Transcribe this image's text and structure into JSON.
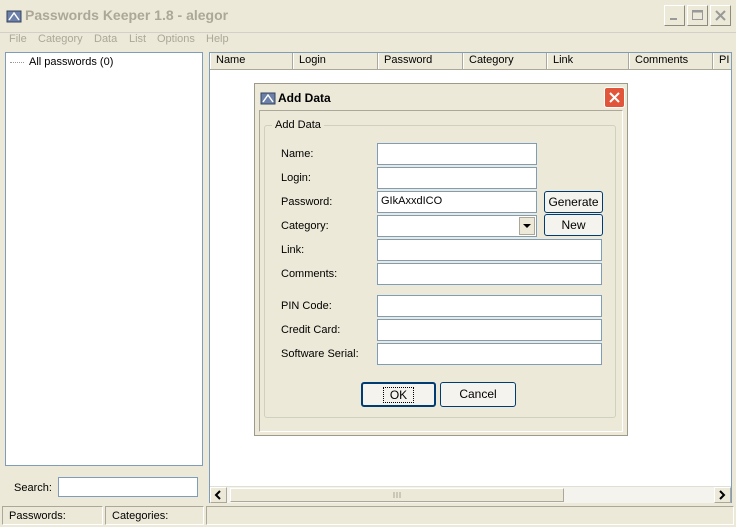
{
  "window": {
    "title": "Passwords Keeper 1.8 - alegor"
  },
  "menu": [
    "File",
    "Category",
    "Data",
    "List",
    "Options",
    "Help"
  ],
  "tree": {
    "root_label": "All passwords (0)"
  },
  "search": {
    "label": "Search:",
    "value": ""
  },
  "list": {
    "columns": [
      "Name",
      "Login",
      "Password",
      "Category",
      "Link",
      "Comments",
      "PI"
    ]
  },
  "status": {
    "passwords_label": "Passwords:",
    "categories_label": "Categories:"
  },
  "dialog": {
    "title": "Add Data",
    "group_title": "Add Data",
    "fields": {
      "name": {
        "label": "Name:",
        "value": ""
      },
      "login": {
        "label": "Login:",
        "value": ""
      },
      "password": {
        "label": "Password:",
        "value": "GIkAxxdICO"
      },
      "category": {
        "label": "Category:",
        "value": ""
      },
      "link": {
        "label": "Link:",
        "value": ""
      },
      "comments": {
        "label": "Comments:",
        "value": ""
      },
      "pin_code": {
        "label": "PIN Code:",
        "value": ""
      },
      "credit_card": {
        "label": "Credit Card:",
        "value": ""
      },
      "software_serial": {
        "label": "Software Serial:",
        "value": ""
      }
    },
    "buttons": {
      "generate": "Generate",
      "new": "New",
      "ok": "OK",
      "cancel": "Cancel"
    }
  },
  "colors": {
    "close_button": "#e1563b",
    "disabled_text": "#aca899",
    "input_border": "#7f9db9"
  },
  "icons": [
    "app-icon",
    "minimize-icon",
    "maximize-icon",
    "close-icon",
    "dialog-icon",
    "dialog-close-icon",
    "dropdown-arrow-icon",
    "scroll-left-icon",
    "scroll-right-icon"
  ]
}
